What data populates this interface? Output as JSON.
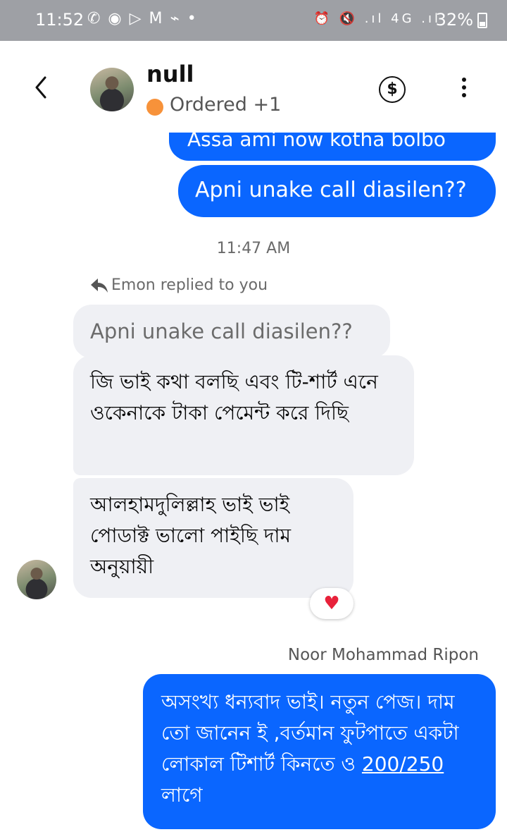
{
  "status_bar": {
    "time": "11:52",
    "left_icons": "✆ ◉ ▷ M ⌁ •",
    "right_icons": "⏰ 🔇 .ıl 4G .ıl",
    "battery": "32%"
  },
  "header": {
    "back_icon": "chevron-left-icon",
    "title": "null",
    "status_label": "Ordered +1",
    "status_color": "#f7923a",
    "payment_icon": "dollar-circle-icon",
    "more_icon": "more-vertical-icon"
  },
  "messages": {
    "clipped_out": "Assa ami now kotha bolbo",
    "call_out": "Apni unake call diasilen??",
    "timestamp": "11:47 AM",
    "reply_label": "Emon replied to you",
    "quoted": "Apni unake call diasilen??",
    "in_1": "জি ভাই কথা বলছি এবং টি-শার্ট এনে ওকেনাকে টাকা পেমেন্ট করে দিছি",
    "in_2": "আলহামদুলিল্লাহ ভাই ভাই পোডাক্ট ভালো পাইছি দাম অনুয়ায়ী",
    "reaction": "♥",
    "sender": "Noor Mohammad Ripon",
    "last_out_pre": "অসংখ্য ধন্যবাদ ভাই। নতুন পেজ। দাম তো জানেন ই ,বর্তমান ফুটপাতে একটা লোকাল টিশার্ট কিনতে ও ",
    "last_out_link": "200/250",
    "last_out_post": " লাগে"
  },
  "colors": {
    "outgoing": "#0a66ff",
    "incoming": "#eff0f4",
    "status_bar": "#9ea0a5"
  }
}
